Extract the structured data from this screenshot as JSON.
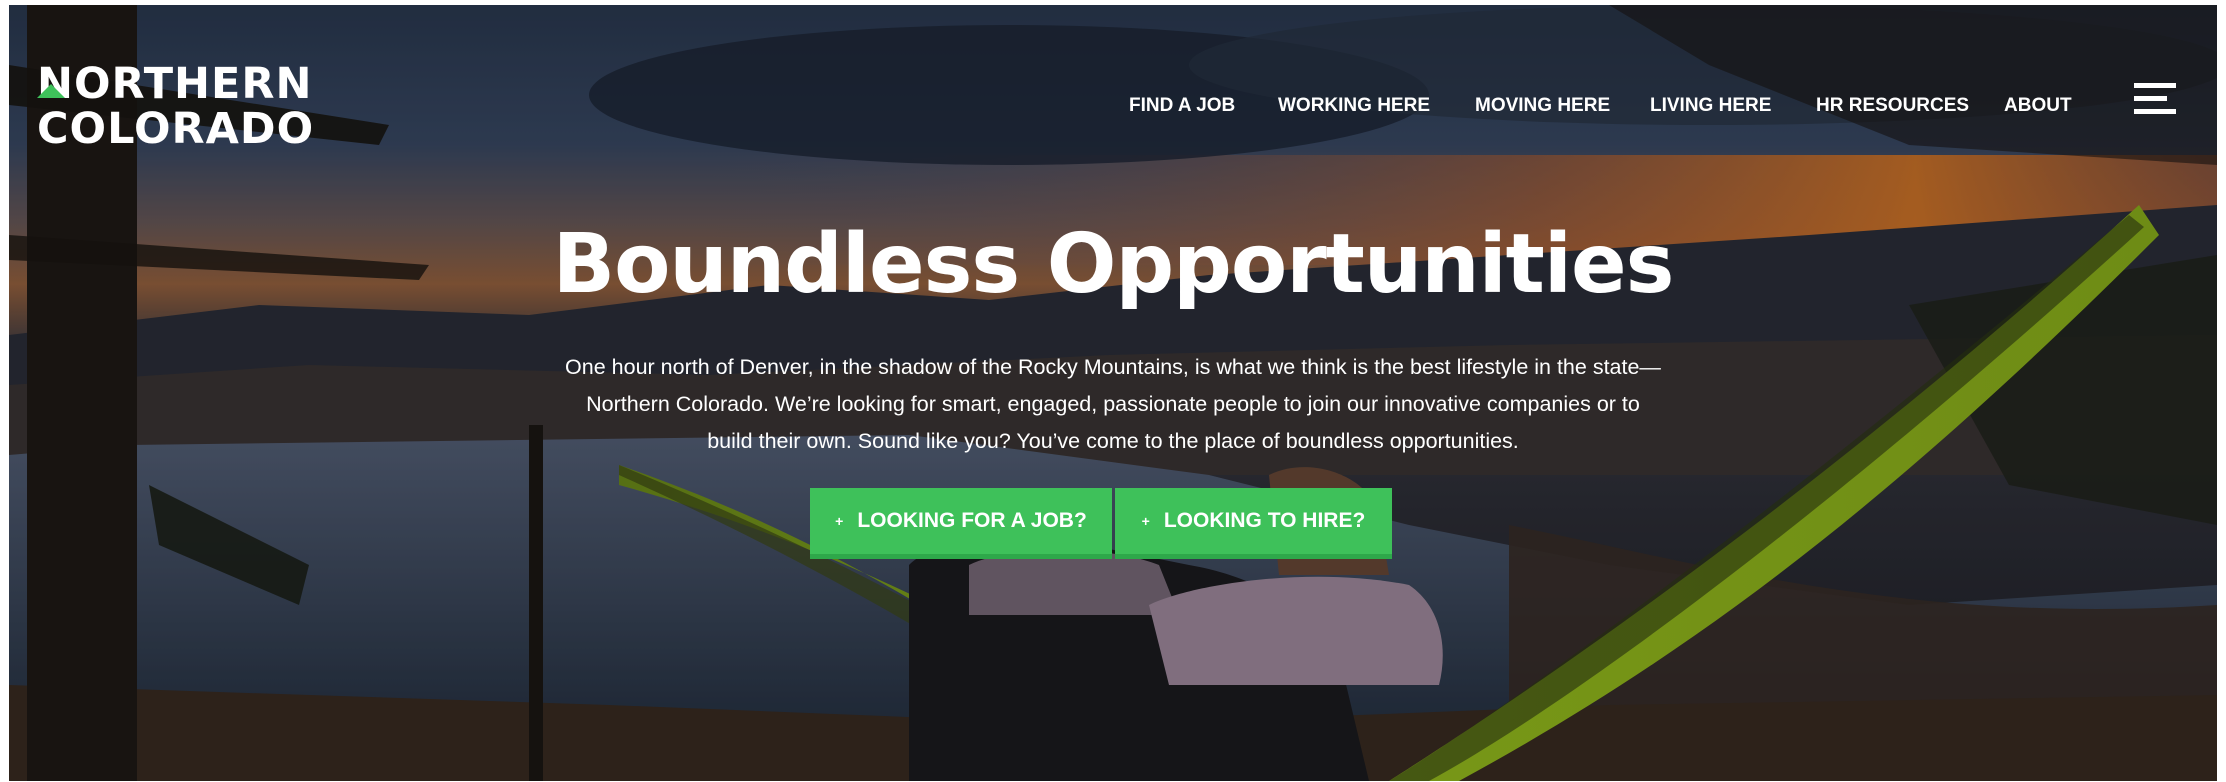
{
  "logo": {
    "line1": "NORTHERN",
    "line2": "COLORADO",
    "accent_color": "#3ec15a"
  },
  "nav": {
    "items": [
      {
        "label": "FIND A JOB"
      },
      {
        "label": "WORKING HERE"
      },
      {
        "label": "MOVING HERE"
      },
      {
        "label": "LIVING HERE"
      },
      {
        "label": "HR RESOURCES"
      },
      {
        "label": "ABOUT"
      }
    ],
    "menu_icon": "hamburger-menu-icon"
  },
  "hero": {
    "headline": "Boundless Opportunities",
    "intro": "One hour north of Denver, in the shadow of the Rocky Mountains, is what we think is the best lifestyle in the state—Northern Colorado. We’re looking for smart, engaged, passionate people to join our innovative companies or to build their own. Sound like you? You’ve come to the place of boundless opportunities.",
    "buttons": [
      {
        "icon": "+",
        "label": "LOOKING FOR A JOB?"
      },
      {
        "icon": "+",
        "label": "LOOKING TO HIRE?"
      }
    ],
    "button_color": "#3ec15a"
  }
}
